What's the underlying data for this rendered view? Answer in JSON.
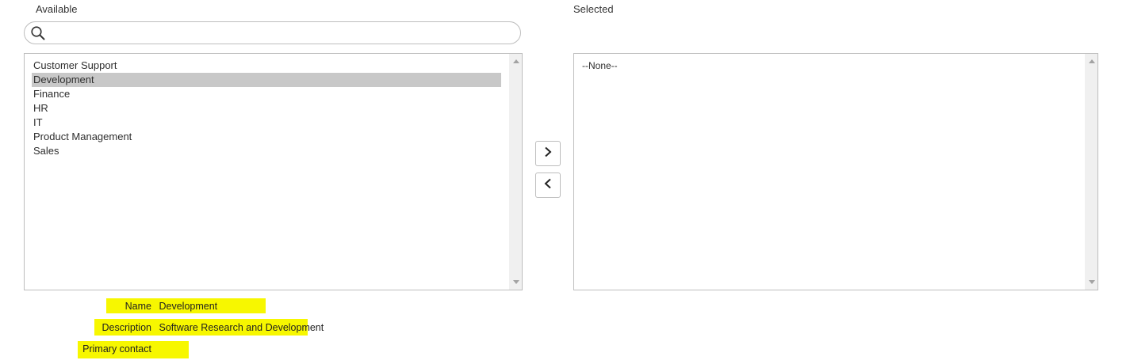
{
  "available_label": "Available",
  "selected_label": "Selected",
  "search": {
    "value": "",
    "placeholder": "",
    "icon": "search-icon"
  },
  "available_items": [
    {
      "label": "Customer Support",
      "selected": false
    },
    {
      "label": "Development",
      "selected": true
    },
    {
      "label": "Finance",
      "selected": false
    },
    {
      "label": "HR",
      "selected": false
    },
    {
      "label": "IT",
      "selected": false
    },
    {
      "label": "Product Management",
      "selected": false
    },
    {
      "label": "Sales",
      "selected": false
    }
  ],
  "selected_items": {
    "empty_label": "--None--"
  },
  "buttons": {
    "add_icon": "chevron-right-icon",
    "remove_icon": "chevron-left-icon"
  },
  "details": {
    "name_label": "Name",
    "name_value": "Development",
    "description_label": "Description",
    "description_value": "Software Research and Development",
    "primary_contact_label": "Primary contact",
    "primary_contact_value": ""
  },
  "colors": {
    "highlight": "#f7f700",
    "selected_row": "#c8c8c8",
    "border": "#bdbdbd",
    "scrollbar": "#f0f0f0"
  }
}
